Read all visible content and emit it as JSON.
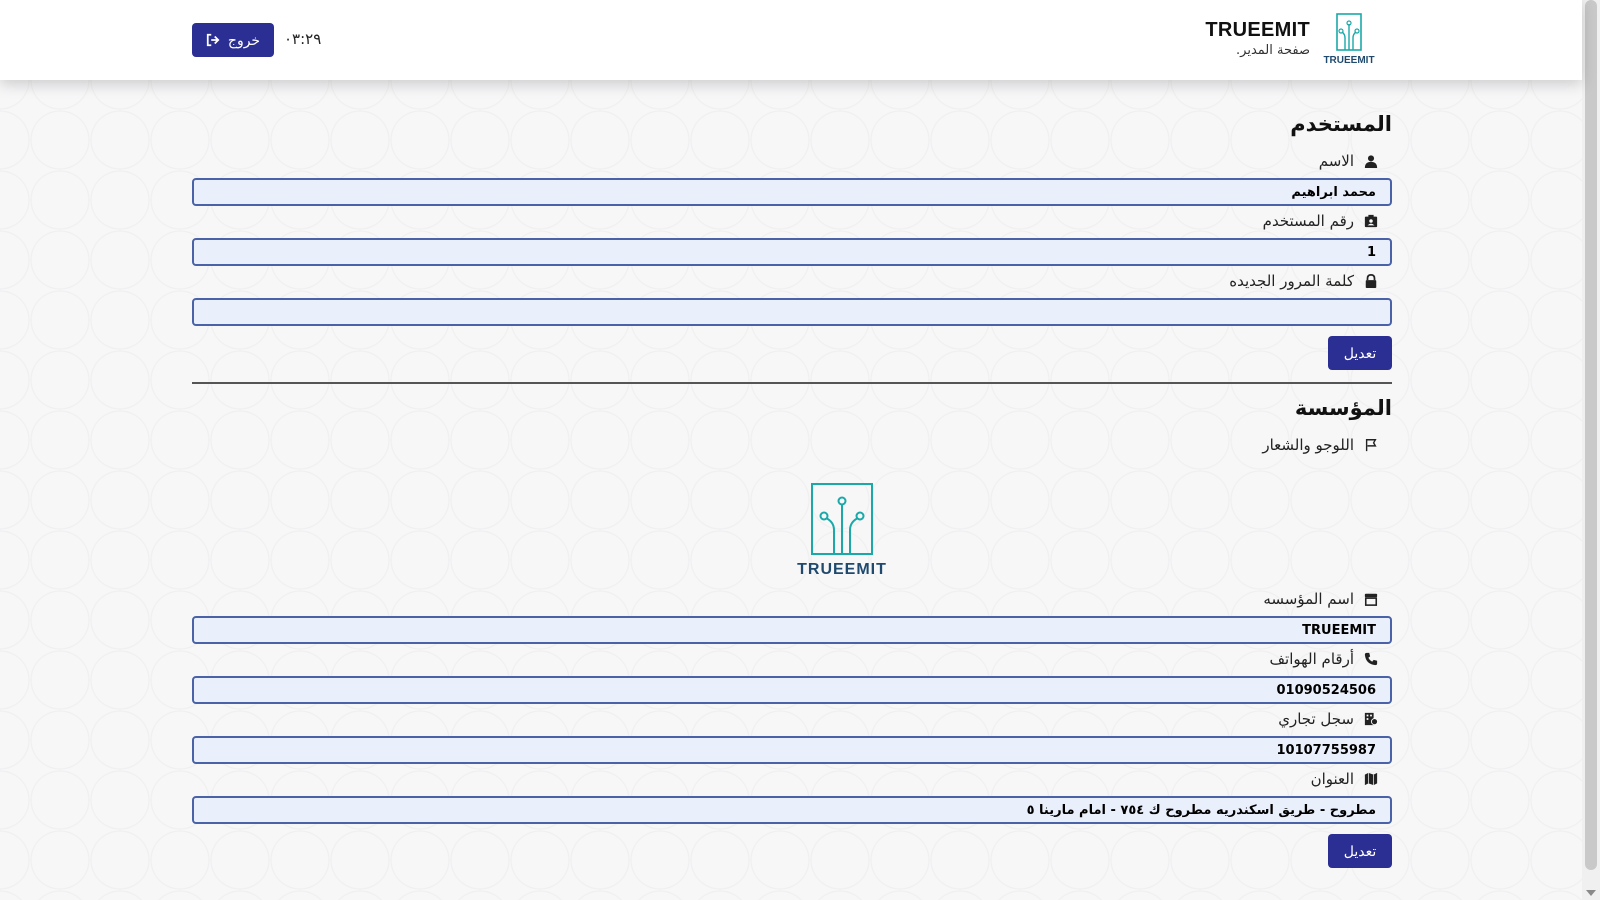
{
  "header": {
    "brand_name": "TRUEEMIT",
    "brand_subtitle": "صفحة المدير.",
    "logo_text": "TRUEEMIT",
    "logout_label": "خروج",
    "clock": "٠٣:٢٩"
  },
  "user_section": {
    "title": "المستخدم",
    "name_label": "الاسم",
    "name_value": "محمد ابراهيم",
    "user_id_label": "رقم المستخدم",
    "user_id_value": "1",
    "password_label": "كلمة المرور الجديده",
    "password_value": "",
    "edit_label": "تعديل"
  },
  "org_section": {
    "title": "المؤسسة",
    "logo_label": "اللوجو والشعار",
    "logo_text": "TRUEEMIT",
    "org_name_label": "اسم المؤسسه",
    "org_name_value": "TRUEEMIT",
    "phones_label": "أرقام الهواتف",
    "phones_value": "01090524506",
    "commercial_reg_label": "سجل تجاري",
    "commercial_reg_value": "10107755987",
    "address_label": "العنوان",
    "address_value": "مطروح - طريق اسكندريه مطروح ك ٧٥٤ - امام مارينا ٥",
    "edit_label": "تعديل"
  },
  "colors": {
    "primary": "#2b2f93",
    "input_border": "#4a63a8",
    "input_bg": "#eaf0fb",
    "logo_teal": "#1aa8a8",
    "logo_text": "#1f4a6e"
  }
}
